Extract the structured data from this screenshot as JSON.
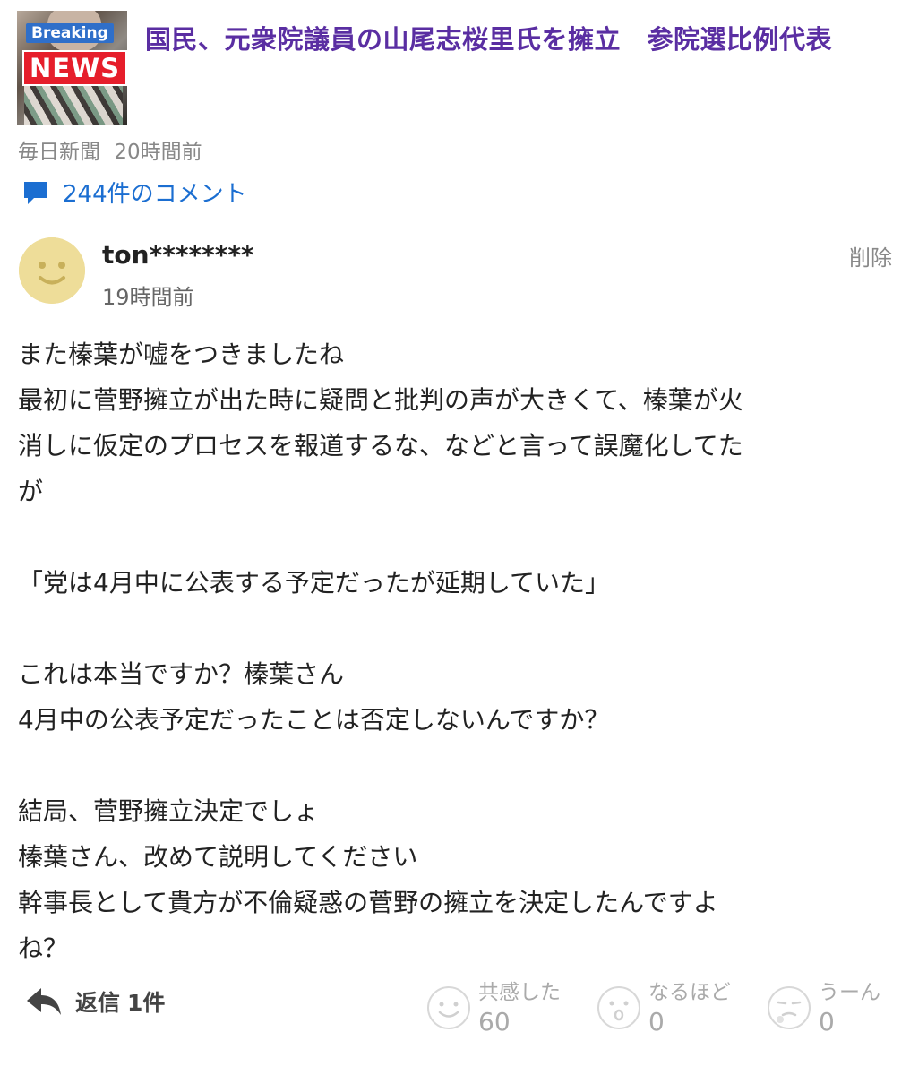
{
  "article": {
    "thumbnail": {
      "badge_top": "Breaking",
      "badge_bottom": "NEWS"
    },
    "title": "国民、元衆院議員の山尾志桜里氏を擁立　参院選比例代表",
    "source": "毎日新聞",
    "time": "20時間前",
    "comments_label": "244件のコメント"
  },
  "comment": {
    "username": "ton********",
    "time": "19時間前",
    "delete_label": "削除",
    "lines": [
      "また榛葉が嘘をつきましたね",
      "最初に菅野擁立が出た時に疑問と批判の声が大きくて、榛葉が火",
      "消しに仮定のプロセスを報道するな、などと言って誤魔化してた",
      "が",
      "",
      "「党は4月中に公表する予定だったが延期していた」",
      "",
      "これは本当ですか？榛葉さん",
      "4月中の公表予定だったことは否定しないんですか？",
      "",
      "結局、菅野擁立決定でしょ",
      "榛葉さん、改めて説明してください",
      "幹事長として貴方が不倫疑惑の菅野の擁立を決定したんですよ",
      "ね？"
    ],
    "reply_label": "返信",
    "reply_count": "1件",
    "reactions": [
      {
        "label": "共感した",
        "count": "60",
        "icon": "smile-reaction-icon"
      },
      {
        "label": "なるほど",
        "count": "0",
        "icon": "surprised-reaction-icon"
      },
      {
        "label": "うーん",
        "count": "0",
        "icon": "thinking-reaction-icon"
      }
    ]
  }
}
